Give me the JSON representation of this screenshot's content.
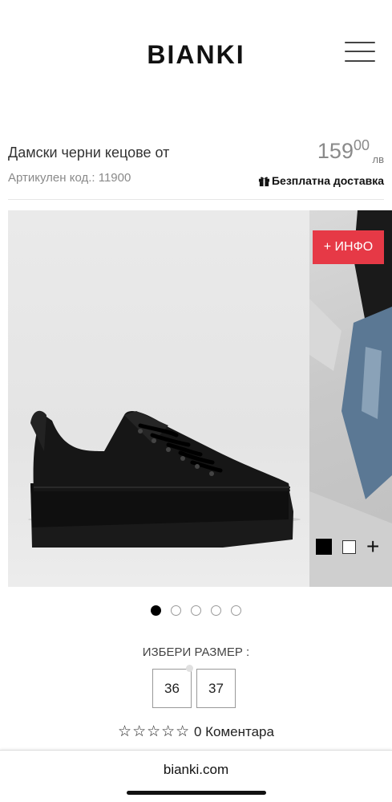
{
  "header": {
    "logo": "BIANKI"
  },
  "product": {
    "title": "Дамски черни кецове от",
    "sku": "Артикулен код.: 11900",
    "price_main": "159",
    "price_cents": "00",
    "currency": "лв",
    "shipping": "Безплатна доставка"
  },
  "gallery": {
    "info_label": "+ ИНФО",
    "colors": [
      "#000000",
      "#ffffff"
    ],
    "add_label": "+",
    "slide_count": 5,
    "active_slide": 1
  },
  "size_selector": {
    "label": "ИЗБЕРИ РАЗМЕР :",
    "options": [
      "36",
      "37"
    ]
  },
  "rating": {
    "stars": "☆☆☆☆☆",
    "comments": "0 Коментара"
  },
  "browser": {
    "domain": "bianki.com"
  }
}
